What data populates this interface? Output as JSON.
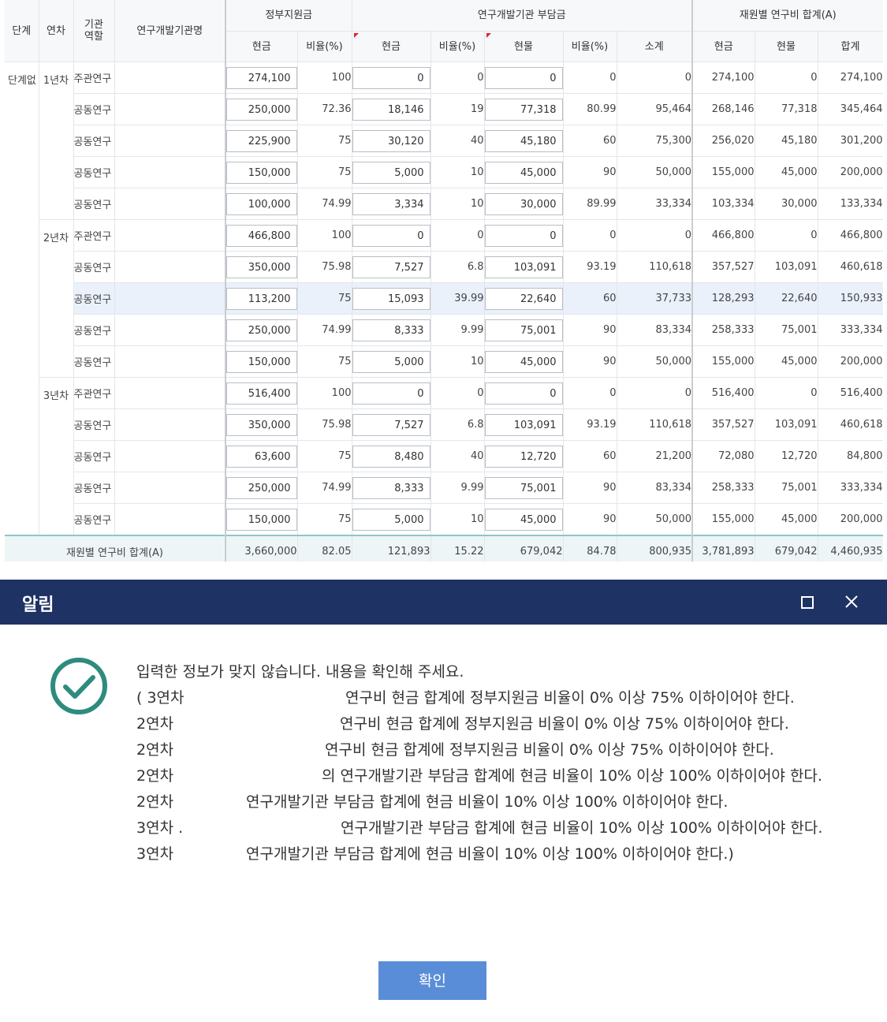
{
  "table": {
    "headers": {
      "stage": "단계",
      "year": "연차",
      "role": "기관\n역할",
      "org": "연구개발기관명",
      "gov": "정부지원금",
      "inst": "연구개발기관 부담금",
      "total": "재원별 연구비 합계(A)",
      "cash": "현금",
      "ratio": "비율(%)",
      "inkind": "현물",
      "subtotal": "소계",
      "sum": "합계"
    },
    "stage_label": "단계없",
    "year_labels": [
      "1년차",
      "2년차",
      "3년차"
    ],
    "rows": [
      {
        "year": "1년차",
        "role": "주관연구",
        "org": "",
        "gov_cash": "274,100",
        "gov_ratio": "100",
        "inst_cash": "0",
        "inst_cash_ratio": "0",
        "inst_inkind": "0",
        "inst_inkind_ratio": "0",
        "inst_subtotal": "0",
        "tot_cash": "274,100",
        "tot_inkind": "0",
        "tot_sum": "274,100"
      },
      {
        "year": "",
        "role": "공동연구",
        "org": "",
        "gov_cash": "250,000",
        "gov_ratio": "72.36",
        "inst_cash": "18,146",
        "inst_cash_ratio": "19",
        "inst_inkind": "77,318",
        "inst_inkind_ratio": "80.99",
        "inst_subtotal": "95,464",
        "tot_cash": "268,146",
        "tot_inkind": "77,318",
        "tot_sum": "345,464"
      },
      {
        "year": "",
        "role": "공동연구",
        "org": "",
        "gov_cash": "225,900",
        "gov_ratio": "75",
        "inst_cash": "30,120",
        "inst_cash_ratio": "40",
        "inst_inkind": "45,180",
        "inst_inkind_ratio": "60",
        "inst_subtotal": "75,300",
        "tot_cash": "256,020",
        "tot_inkind": "45,180",
        "tot_sum": "301,200"
      },
      {
        "year": "",
        "role": "공동연구",
        "org": "",
        "gov_cash": "150,000",
        "gov_ratio": "75",
        "inst_cash": "5,000",
        "inst_cash_ratio": "10",
        "inst_inkind": "45,000",
        "inst_inkind_ratio": "90",
        "inst_subtotal": "50,000",
        "tot_cash": "155,000",
        "tot_inkind": "45,000",
        "tot_sum": "200,000"
      },
      {
        "year": "",
        "role": "공동연구",
        "org": "",
        "gov_cash": "100,000",
        "gov_ratio": "74.99",
        "inst_cash": "3,334",
        "inst_cash_ratio": "10",
        "inst_inkind": "30,000",
        "inst_inkind_ratio": "89.99",
        "inst_subtotal": "33,334",
        "tot_cash": "103,334",
        "tot_inkind": "30,000",
        "tot_sum": "133,334"
      },
      {
        "year": "2년차",
        "role": "주관연구",
        "org": "",
        "gov_cash": "466,800",
        "gov_ratio": "100",
        "inst_cash": "0",
        "inst_cash_ratio": "0",
        "inst_inkind": "0",
        "inst_inkind_ratio": "0",
        "inst_subtotal": "0",
        "tot_cash": "466,800",
        "tot_inkind": "0",
        "tot_sum": "466,800"
      },
      {
        "year": "",
        "role": "공동연구",
        "org": "",
        "gov_cash": "350,000",
        "gov_ratio": "75.98",
        "inst_cash": "7,527",
        "inst_cash_ratio": "6.8",
        "inst_inkind": "103,091",
        "inst_inkind_ratio": "93.19",
        "inst_subtotal": "110,618",
        "tot_cash": "357,527",
        "tot_inkind": "103,091",
        "tot_sum": "460,618"
      },
      {
        "year": "",
        "role": "공동연구",
        "org": "",
        "gov_cash": "113,200",
        "gov_ratio": "75",
        "inst_cash": "15,093",
        "inst_cash_ratio": "39.99",
        "inst_inkind": "22,640",
        "inst_inkind_ratio": "60",
        "inst_subtotal": "37,733",
        "tot_cash": "128,293",
        "tot_inkind": "22,640",
        "tot_sum": "150,933"
      },
      {
        "year": "",
        "role": "공동연구",
        "org": "",
        "gov_cash": "250,000",
        "gov_ratio": "74.99",
        "inst_cash": "8,333",
        "inst_cash_ratio": "9.99",
        "inst_inkind": "75,001",
        "inst_inkind_ratio": "90",
        "inst_subtotal": "83,334",
        "tot_cash": "258,333",
        "tot_inkind": "75,001",
        "tot_sum": "333,334"
      },
      {
        "year": "",
        "role": "공동연구",
        "org": "",
        "gov_cash": "150,000",
        "gov_ratio": "75",
        "inst_cash": "5,000",
        "inst_cash_ratio": "10",
        "inst_inkind": "45,000",
        "inst_inkind_ratio": "90",
        "inst_subtotal": "50,000",
        "tot_cash": "155,000",
        "tot_inkind": "45,000",
        "tot_sum": "200,000"
      },
      {
        "year": "3년차",
        "role": "주관연구",
        "org": "",
        "gov_cash": "516,400",
        "gov_ratio": "100",
        "inst_cash": "0",
        "inst_cash_ratio": "0",
        "inst_inkind": "0",
        "inst_inkind_ratio": "0",
        "inst_subtotal": "0",
        "tot_cash": "516,400",
        "tot_inkind": "0",
        "tot_sum": "516,400"
      },
      {
        "year": "",
        "role": "공동연구",
        "org": "",
        "gov_cash": "350,000",
        "gov_ratio": "75.98",
        "inst_cash": "7,527",
        "inst_cash_ratio": "6.8",
        "inst_inkind": "103,091",
        "inst_inkind_ratio": "93.19",
        "inst_subtotal": "110,618",
        "tot_cash": "357,527",
        "tot_inkind": "103,091",
        "tot_sum": "460,618"
      },
      {
        "year": "",
        "role": "공동연구",
        "org": "",
        "gov_cash": "63,600",
        "gov_ratio": "75",
        "inst_cash": "8,480",
        "inst_cash_ratio": "40",
        "inst_inkind": "12,720",
        "inst_inkind_ratio": "60",
        "inst_subtotal": "21,200",
        "tot_cash": "72,080",
        "tot_inkind": "12,720",
        "tot_sum": "84,800"
      },
      {
        "year": "",
        "role": "공동연구",
        "org": "",
        "gov_cash": "250,000",
        "gov_ratio": "74.99",
        "inst_cash": "8,333",
        "inst_cash_ratio": "9.99",
        "inst_inkind": "75,001",
        "inst_inkind_ratio": "90",
        "inst_subtotal": "83,334",
        "tot_cash": "258,333",
        "tot_inkind": "75,001",
        "tot_sum": "333,334"
      },
      {
        "year": "",
        "role": "공동연구",
        "org": "",
        "gov_cash": "150,000",
        "gov_ratio": "75",
        "inst_cash": "5,000",
        "inst_cash_ratio": "10",
        "inst_inkind": "45,000",
        "inst_inkind_ratio": "90",
        "inst_subtotal": "50,000",
        "tot_cash": "155,000",
        "tot_inkind": "45,000",
        "tot_sum": "200,000"
      }
    ],
    "selected_row": 7,
    "total_row": {
      "label": "재원별 연구비 합계(A)",
      "values": [
        "3,660,000",
        "82.05",
        "121,893",
        "15.22",
        "679,042",
        "84.78",
        "800,935",
        "3,781,893",
        "679,042",
        "4,460,935"
      ]
    }
  },
  "modal": {
    "title": "알림",
    "maximize_icon": "square-icon",
    "close_icon": "close-icon",
    "check_icon": "check-circle-icon",
    "accent_color": "#2e8b7f",
    "header_color": "#1e3364",
    "button_color": "#5a8dd8",
    "message_lines": [
      {
        "a": "입력한 정보가 맞지 않습니다. 내용을 확인해 주세요.",
        "b": ""
      },
      {
        "a": "( 3연차",
        "b": "연구비 현금 합계에 정부지원금 비율이 0% 이상 75% 이하이어야 한다."
      },
      {
        "a": " 2연차",
        "b": "연구비 현금 합계에 정부지원금 비율이 0% 이상 75% 이하이어야 한다."
      },
      {
        "a": " 2연차",
        "b": "연구비 현금 합계에 정부지원금 비율이 0% 이상 75% 이하이어야 한다."
      },
      {
        "a": " 2연차",
        "b": "의 연구개발기관 부담금 합계에 현금 비율이 10% 이상 100% 이하이어야 한다."
      },
      {
        "a": " 2연차",
        "b": "연구개발기관 부담금 합계에 현금 비율이 10% 이상 100% 이하이어야 한다."
      },
      {
        "a": " 3연차 .",
        "b": "연구개발기관 부담금 합계에 현금 비율이 10% 이상 100% 이하이어야 한다."
      },
      {
        "a": " 3연차",
        "b": "연구개발기관 부담금 합계에 현금 비율이 10% 이상 100% 이하이어야 한다.)"
      }
    ],
    "ok_label": "확인"
  }
}
